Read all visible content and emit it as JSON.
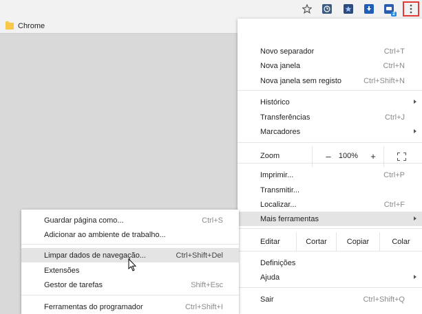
{
  "toolbar": {
    "icons": [
      "star-icon",
      "extension-icon-1",
      "extension-icon-2",
      "extension-icon-3",
      "extension-icon-4"
    ],
    "badge": "2",
    "accent": "#e53935"
  },
  "bookmarks": {
    "folder_label": "Chrome"
  },
  "menu": {
    "new_tab": {
      "label": "Novo separador",
      "shortcut": "Ctrl+T"
    },
    "new_window": {
      "label": "Nova janela",
      "shortcut": "Ctrl+N"
    },
    "incognito": {
      "label": "Nova janela sem registo",
      "shortcut": "Ctrl+Shift+N"
    },
    "history": {
      "label": "Histórico"
    },
    "downloads": {
      "label": "Transferências",
      "shortcut": "Ctrl+J"
    },
    "bookmarks": {
      "label": "Marcadores"
    },
    "zoom": {
      "label": "Zoom",
      "minus": "–",
      "value": "100%",
      "plus": "+"
    },
    "print": {
      "label": "Imprimir...",
      "shortcut": "Ctrl+P"
    },
    "cast": {
      "label": "Transmitir..."
    },
    "find": {
      "label": "Localizar...",
      "shortcut": "Ctrl+F"
    },
    "more_tools": {
      "label": "Mais ferramentas"
    },
    "edit": {
      "label": "Editar",
      "cut": "Cortar",
      "copy": "Copiar",
      "paste": "Colar"
    },
    "settings": {
      "label": "Definições"
    },
    "help": {
      "label": "Ajuda"
    },
    "exit": {
      "label": "Sair",
      "shortcut": "Ctrl+Shift+Q"
    }
  },
  "submenu": {
    "save_page": {
      "label": "Guardar página como...",
      "shortcut": "Ctrl+S"
    },
    "add_desktop": {
      "label": "Adicionar ao ambiente de trabalho..."
    },
    "clear_data": {
      "label": "Limpar dados de navegação...",
      "shortcut": "Ctrl+Shift+Del"
    },
    "extensions": {
      "label": "Extensões"
    },
    "task_manager": {
      "label": "Gestor de tarefas",
      "shortcut": "Shift+Esc"
    },
    "dev_tools": {
      "label": "Ferramentas do programador",
      "shortcut": "Ctrl+Shift+I"
    }
  }
}
